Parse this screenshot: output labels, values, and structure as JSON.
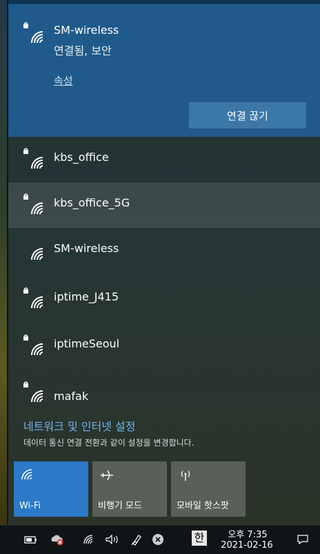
{
  "connected": {
    "name": "SM-wireless",
    "status": "연결됨, 보안",
    "properties_link": "속성",
    "disconnect_label": "연결 끊기"
  },
  "networks": [
    {
      "name": "kbs_office",
      "secured": true
    },
    {
      "name": "kbs_office_5G",
      "secured": true
    },
    {
      "name": "SM-wireless",
      "secured": false
    },
    {
      "name": "iptime_J415",
      "secured": true
    },
    {
      "name": "iptimeSeoul",
      "secured": true
    },
    {
      "name": "mafak",
      "secured": true
    }
  ],
  "settings": {
    "link": "네트워크 및 인터넷 설정",
    "description": "데이터 통신 연결 전환과 같이 설정을 변경합니다."
  },
  "quick_actions": [
    {
      "label": "Wi-Fi",
      "active": true,
      "icon": "wifi-icon"
    },
    {
      "label": "비행기 모드",
      "active": false,
      "icon": "airplane-icon"
    },
    {
      "label": "모바일 핫스팟",
      "active": false,
      "icon": "hotspot-icon"
    }
  ],
  "taskbar": {
    "time": "오후 7:35",
    "date": "2021-02-16",
    "ime": "한"
  },
  "colors": {
    "accent": "#2b79c7",
    "connected_bg": "#1f5a8a",
    "link": "#6fb4ef"
  }
}
